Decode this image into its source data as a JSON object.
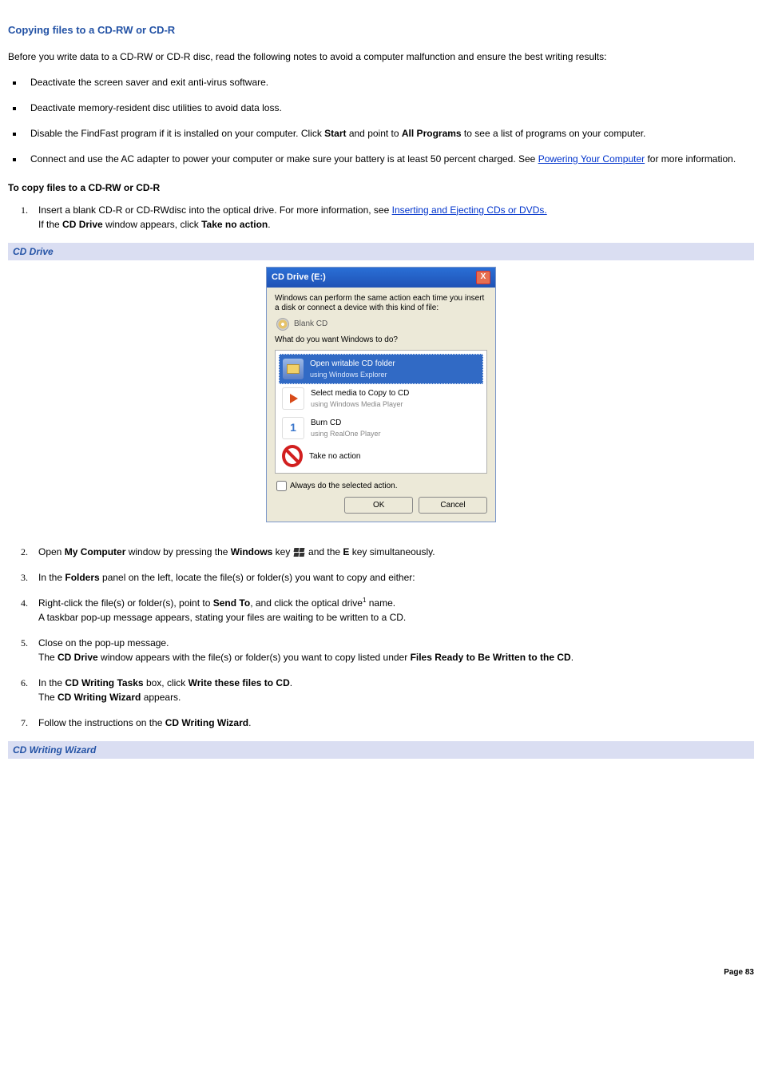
{
  "title": "Copying files to a CD-RW or CD-R",
  "intro": "Before you write data to a CD-RW or CD-R disc, read the following notes to avoid a computer malfunction and ensure the best writing results:",
  "notes": {
    "n1": "Deactivate the screen saver and exit anti-virus software.",
    "n2": "Deactivate memory-resident disc utilities to avoid data loss.",
    "n3a": "Disable the FindFast program if it is installed on your computer. Click ",
    "n3b": "Start",
    "n3c": " and point to ",
    "n3d": "All Programs",
    "n3e": " to see a list of programs on your computer.",
    "n4a": "Connect and use the AC adapter to power your computer or make sure your battery is at least 50 percent charged. See ",
    "n4link": "Powering Your Computer",
    "n4b": " for more information."
  },
  "subhead": "To copy files to a CD-RW or CD-R",
  "steps": {
    "s1a": "Insert a blank CD-R or CD-RWdisc into the optical drive. For more information, see ",
    "s1link": "Inserting and Ejecting CDs or DVDs.",
    "s1b_pre": "If the ",
    "s1b_bold1": "CD Drive",
    "s1b_mid": " window appears, click ",
    "s1b_bold2": "Take no action",
    "s1b_end": ".",
    "s2a": "Open ",
    "s2b": "My Computer",
    "s2c": " window by pressing the ",
    "s2d": "Windows",
    "s2e": " key ",
    "s2f": " and the ",
    "s2g": "E",
    "s2h": " key simultaneously.",
    "s3a": "In the ",
    "s3b": "Folders",
    "s3c": " panel on the left, locate the file(s) or folder(s) you want to copy and either:",
    "s4a": "Right-click the file(s) or folder(s), point to ",
    "s4b": "Send To",
    "s4c": ", and click the optical drive",
    "s4foot": "1",
    "s4d": " name.",
    "s4line2": "A taskbar pop-up message appears, stating your files are waiting to be written to a CD.",
    "s5a": "Close on the pop-up message.",
    "s5b_pre": "The ",
    "s5b_b1": "CD Drive",
    "s5b_mid": " window appears with the file(s) or folder(s) you want to copy listed under ",
    "s5b_b2": "Files Ready to Be Written to the CD",
    "s5b_end": ".",
    "s6a": "In the ",
    "s6b": "CD Writing Tasks",
    "s6c": " box, click ",
    "s6d": "Write these files to CD",
    "s6e": ".",
    "s6line2a": "The ",
    "s6line2b": "CD Writing Wizard",
    "s6line2c": " appears.",
    "s7a": "Follow the instructions on the ",
    "s7b": "CD Writing Wizard",
    "s7c": "."
  },
  "captions": {
    "cd_drive": "CD Drive",
    "cd_wizard": "CD Writing Wizard"
  },
  "dialog": {
    "title": "CD Drive (E:)",
    "msg": "Windows can perform the same action each time you insert a disk or connect a device with this kind of file:",
    "media": "Blank CD",
    "prompt": "What do you want Windows to do?",
    "opt1_t": "Open writable CD folder",
    "opt1_s": "using Windows Explorer",
    "opt2_t": "Select media to Copy to CD",
    "opt2_s": "using Windows Media Player",
    "opt3_t": "Burn CD",
    "opt3_s": "using RealOne Player",
    "opt4_t": "Take no action",
    "always": "Always do the selected action.",
    "ok": "OK",
    "cancel": "Cancel"
  },
  "page": "Page 83"
}
